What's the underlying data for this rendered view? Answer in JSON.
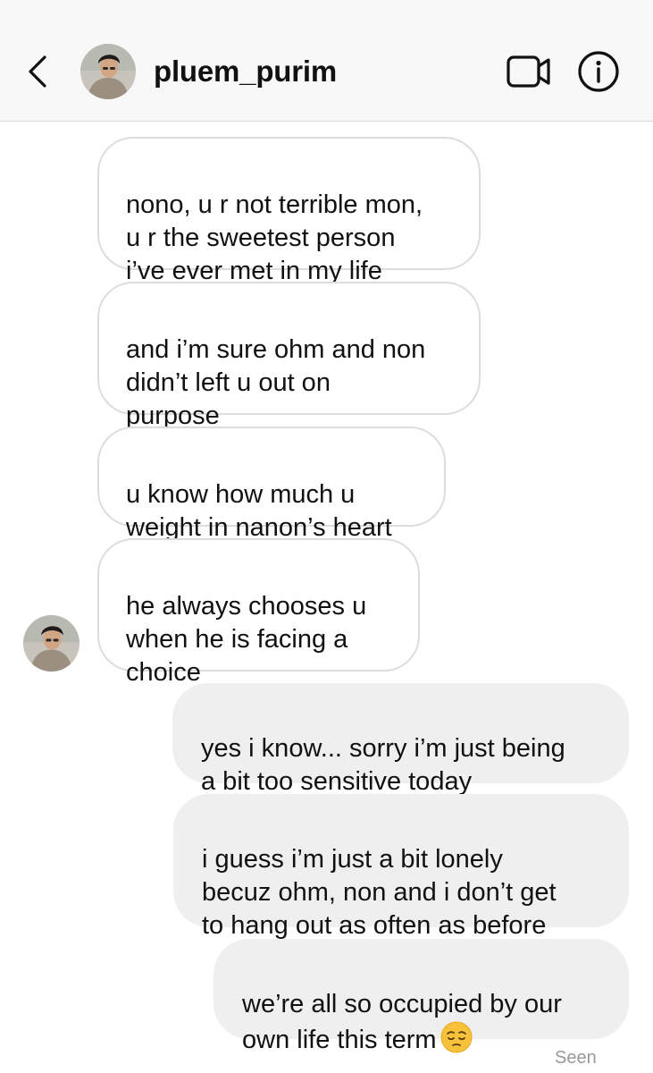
{
  "header": {
    "username": "pluem_purim",
    "back_icon": "chevron-left-icon",
    "video_icon": "video-camera-icon",
    "info_icon": "info-icon"
  },
  "messages": [
    {
      "sender": "them",
      "text": "nono, u r not terrible mon,\nu r the sweetest person\ni’ve ever met in my life"
    },
    {
      "sender": "them",
      "text": "and i’m sure ohm and non\ndidn’t left u out on\npurpose"
    },
    {
      "sender": "them",
      "text": "u know how much u\nweight in nanon’s heart"
    },
    {
      "sender": "them",
      "text": "he always chooses u\nwhen he is facing a\nchoice"
    },
    {
      "sender": "me",
      "text": "yes i know... sorry i’m just being\na bit too sensitive today"
    },
    {
      "sender": "me",
      "text": "i guess i’m just a bit lonely\nbecuz ohm, non and i don’t get\nto hang out as often as before"
    },
    {
      "sender": "me",
      "text": "we’re all so occupied by our\nown life this term",
      "emoji": "pensive-face"
    }
  ],
  "status": {
    "seen": "Seen"
  },
  "colors": {
    "incoming_border": "#dcdcdc",
    "outgoing_bg": "#efefef",
    "header_bg": "#f8f8f8",
    "seen_text": "#999999"
  }
}
